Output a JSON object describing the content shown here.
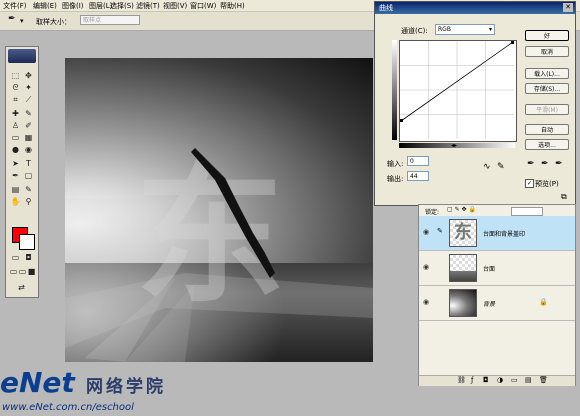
{
  "menubar": {
    "items": [
      "文件(F)",
      "编辑(E)",
      "图像(I)",
      "图层(L)",
      "选择(S)",
      "滤镜(T)",
      "视图(V)",
      "窗口(W)",
      "帮助(H)"
    ]
  },
  "options_bar": {
    "sample_size_label": "取样大小：",
    "sample_size_value": "取样点"
  },
  "toolbox": {
    "foreground_color": "#ff0000",
    "background_color": "#ffffff"
  },
  "canvas": {
    "overlay_char": "东"
  },
  "curves_dialog": {
    "title": "曲线",
    "channel_label": "通道(C):",
    "channel_value": "RGB",
    "input_label": "输入:",
    "input_value": "0",
    "output_label": "输出:",
    "output_value": "44",
    "buttons": {
      "ok": "好",
      "cancel": "取消",
      "load": "载入(L)...",
      "save": "存储(S)...",
      "smooth": "平滑(M)",
      "auto": "自动",
      "options": "选项..."
    },
    "preview_label": "预览(P)",
    "preview_checked": true
  },
  "layers_panel": {
    "lock_label": "锁定:",
    "layers": [
      {
        "name": "台面和背景盖印",
        "active": true
      },
      {
        "name": "台面",
        "active": false
      },
      {
        "name": "背景",
        "active": false
      }
    ]
  },
  "watermark": {
    "logo": "eNet",
    "cn_text": "网络学院",
    "url": "www.eNet.com.cn/eschool"
  }
}
